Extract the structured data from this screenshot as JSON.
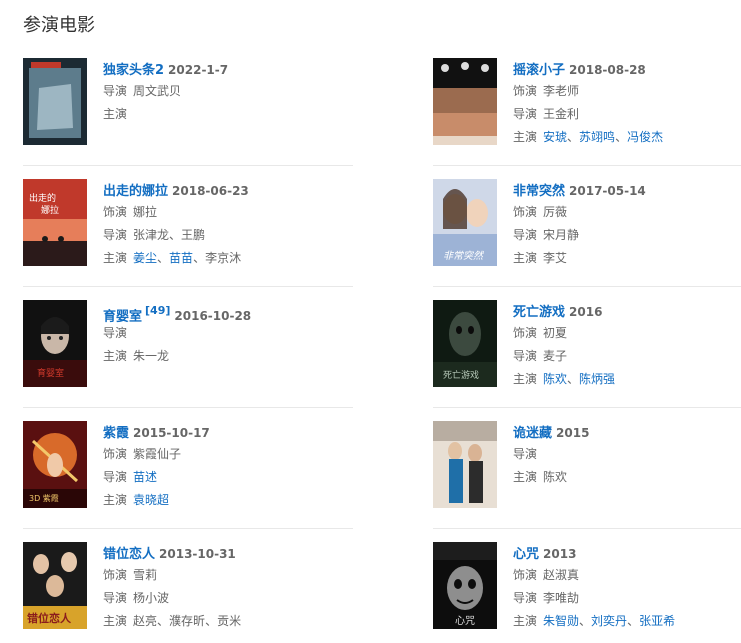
{
  "section": {
    "title": "参演电影"
  },
  "labels": {
    "role": "饰演",
    "director": "导演",
    "starring": "主演"
  },
  "films": [
    {
      "title": "独家头条2",
      "date": "2022-1-7",
      "director": [
        {
          "name": "周文武贝",
          "link": false
        }
      ],
      "starring": [],
      "poster_icon": "poster-dujiatoutiao2"
    },
    {
      "title": "摇滚小子",
      "date": "2018-08-28",
      "role": [
        {
          "name": "李老师",
          "link": false
        }
      ],
      "director": [
        {
          "name": "王金利",
          "link": false
        }
      ],
      "starring": [
        {
          "name": "安琥",
          "link": true
        },
        {
          "name": "苏翊鸣",
          "link": true
        },
        {
          "name": "冯俊杰",
          "link": true
        }
      ],
      "poster_icon": "poster-yaogunxiaozi"
    },
    {
      "title": "出走的娜拉",
      "date": "2018-06-23",
      "role": [
        {
          "name": "娜拉",
          "link": false
        }
      ],
      "director": [
        {
          "name": "张津龙",
          "link": false
        },
        {
          "name": "王鹏",
          "link": false
        }
      ],
      "starring": [
        {
          "name": "姜尘",
          "link": true
        },
        {
          "name": "苗苗",
          "link": true
        },
        {
          "name": "李京沐",
          "link": false
        }
      ],
      "poster_icon": "poster-chuzoudenala"
    },
    {
      "title": "非常突然",
      "date": "2017-05-14",
      "role": [
        {
          "name": "厉薇",
          "link": false
        }
      ],
      "director": [
        {
          "name": "宋月静",
          "link": false
        }
      ],
      "starring": [
        {
          "name": "李艾",
          "link": false
        }
      ],
      "poster_icon": "poster-feichangturan"
    },
    {
      "title": "育婴室",
      "cite": "[49]",
      "date": "2016-10-28",
      "director": [],
      "starring": [
        {
          "name": "朱一龙",
          "link": false
        }
      ],
      "poster_icon": "poster-yuyingshi"
    },
    {
      "title": "死亡游戏",
      "date": "2016",
      "role": [
        {
          "name": "初夏",
          "link": false
        }
      ],
      "director": [
        {
          "name": "麦子",
          "link": false
        }
      ],
      "starring": [
        {
          "name": "陈欢",
          "link": true
        },
        {
          "name": "陈炳强",
          "link": true
        }
      ],
      "poster_icon": "poster-siwangyouxi"
    },
    {
      "title": "紫霞",
      "date": "2015-10-17",
      "role": [
        {
          "name": "紫霞仙子",
          "link": false
        }
      ],
      "director": [
        {
          "name": "苗述",
          "link": true
        }
      ],
      "starring": [
        {
          "name": "袁晓超",
          "link": true
        }
      ],
      "poster_icon": "poster-zixia"
    },
    {
      "title": "诡迷藏",
      "date": "2015",
      "director": [],
      "starring": [
        {
          "name": "陈欢",
          "link": false
        }
      ],
      "poster_icon": "poster-guimicang"
    },
    {
      "title": "错位恋人",
      "date": "2013-10-31",
      "role": [
        {
          "name": "雪莉",
          "link": false
        }
      ],
      "director": [
        {
          "name": "杨小波",
          "link": false
        }
      ],
      "starring": [
        {
          "name": "赵亮",
          "link": false
        },
        {
          "name": "濮存昕",
          "link": false
        },
        {
          "name": "贡米",
          "link": false
        }
      ],
      "poster_icon": "poster-cuoweilianren",
      "poster_text": "错位恋人"
    },
    {
      "title": "心咒",
      "date": "2013",
      "role": [
        {
          "name": "赵淑真",
          "link": false
        }
      ],
      "director": [
        {
          "name": "李唯劼",
          "link": false
        }
      ],
      "starring": [
        {
          "name": "朱智勋",
          "link": true
        },
        {
          "name": "刘奕丹",
          "link": true
        },
        {
          "name": "张亚希",
          "link": true
        }
      ],
      "poster_icon": "poster-xinzhou",
      "poster_text": "心咒"
    }
  ]
}
